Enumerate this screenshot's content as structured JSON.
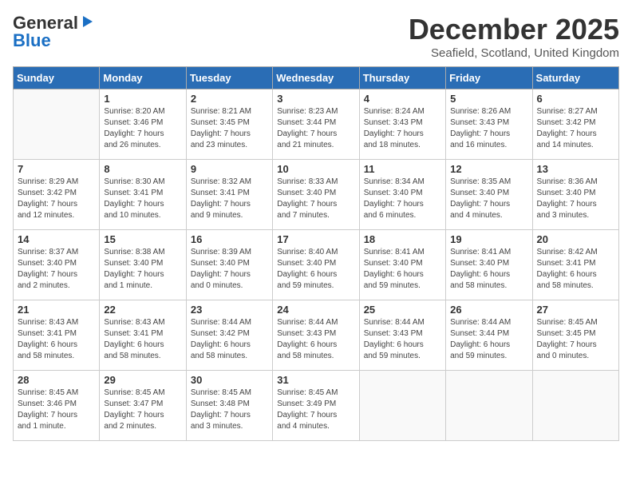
{
  "logo": {
    "line1": "General",
    "line2": "Blue"
  },
  "title": "December 2025",
  "location": "Seafield, Scotland, United Kingdom",
  "weekdays": [
    "Sunday",
    "Monday",
    "Tuesday",
    "Wednesday",
    "Thursday",
    "Friday",
    "Saturday"
  ],
  "weeks": [
    [
      {
        "day": "",
        "info": ""
      },
      {
        "day": "1",
        "info": "Sunrise: 8:20 AM\nSunset: 3:46 PM\nDaylight: 7 hours\nand 26 minutes."
      },
      {
        "day": "2",
        "info": "Sunrise: 8:21 AM\nSunset: 3:45 PM\nDaylight: 7 hours\nand 23 minutes."
      },
      {
        "day": "3",
        "info": "Sunrise: 8:23 AM\nSunset: 3:44 PM\nDaylight: 7 hours\nand 21 minutes."
      },
      {
        "day": "4",
        "info": "Sunrise: 8:24 AM\nSunset: 3:43 PM\nDaylight: 7 hours\nand 18 minutes."
      },
      {
        "day": "5",
        "info": "Sunrise: 8:26 AM\nSunset: 3:43 PM\nDaylight: 7 hours\nand 16 minutes."
      },
      {
        "day": "6",
        "info": "Sunrise: 8:27 AM\nSunset: 3:42 PM\nDaylight: 7 hours\nand 14 minutes."
      }
    ],
    [
      {
        "day": "7",
        "info": "Sunrise: 8:29 AM\nSunset: 3:42 PM\nDaylight: 7 hours\nand 12 minutes."
      },
      {
        "day": "8",
        "info": "Sunrise: 8:30 AM\nSunset: 3:41 PM\nDaylight: 7 hours\nand 10 minutes."
      },
      {
        "day": "9",
        "info": "Sunrise: 8:32 AM\nSunset: 3:41 PM\nDaylight: 7 hours\nand 9 minutes."
      },
      {
        "day": "10",
        "info": "Sunrise: 8:33 AM\nSunset: 3:40 PM\nDaylight: 7 hours\nand 7 minutes."
      },
      {
        "day": "11",
        "info": "Sunrise: 8:34 AM\nSunset: 3:40 PM\nDaylight: 7 hours\nand 6 minutes."
      },
      {
        "day": "12",
        "info": "Sunrise: 8:35 AM\nSunset: 3:40 PM\nDaylight: 7 hours\nand 4 minutes."
      },
      {
        "day": "13",
        "info": "Sunrise: 8:36 AM\nSunset: 3:40 PM\nDaylight: 7 hours\nand 3 minutes."
      }
    ],
    [
      {
        "day": "14",
        "info": "Sunrise: 8:37 AM\nSunset: 3:40 PM\nDaylight: 7 hours\nand 2 minutes."
      },
      {
        "day": "15",
        "info": "Sunrise: 8:38 AM\nSunset: 3:40 PM\nDaylight: 7 hours\nand 1 minute."
      },
      {
        "day": "16",
        "info": "Sunrise: 8:39 AM\nSunset: 3:40 PM\nDaylight: 7 hours\nand 0 minutes."
      },
      {
        "day": "17",
        "info": "Sunrise: 8:40 AM\nSunset: 3:40 PM\nDaylight: 6 hours\nand 59 minutes."
      },
      {
        "day": "18",
        "info": "Sunrise: 8:41 AM\nSunset: 3:40 PM\nDaylight: 6 hours\nand 59 minutes."
      },
      {
        "day": "19",
        "info": "Sunrise: 8:41 AM\nSunset: 3:40 PM\nDaylight: 6 hours\nand 58 minutes."
      },
      {
        "day": "20",
        "info": "Sunrise: 8:42 AM\nSunset: 3:41 PM\nDaylight: 6 hours\nand 58 minutes."
      }
    ],
    [
      {
        "day": "21",
        "info": "Sunrise: 8:43 AM\nSunset: 3:41 PM\nDaylight: 6 hours\nand 58 minutes."
      },
      {
        "day": "22",
        "info": "Sunrise: 8:43 AM\nSunset: 3:41 PM\nDaylight: 6 hours\nand 58 minutes."
      },
      {
        "day": "23",
        "info": "Sunrise: 8:44 AM\nSunset: 3:42 PM\nDaylight: 6 hours\nand 58 minutes."
      },
      {
        "day": "24",
        "info": "Sunrise: 8:44 AM\nSunset: 3:43 PM\nDaylight: 6 hours\nand 58 minutes."
      },
      {
        "day": "25",
        "info": "Sunrise: 8:44 AM\nSunset: 3:43 PM\nDaylight: 6 hours\nand 59 minutes."
      },
      {
        "day": "26",
        "info": "Sunrise: 8:44 AM\nSunset: 3:44 PM\nDaylight: 6 hours\nand 59 minutes."
      },
      {
        "day": "27",
        "info": "Sunrise: 8:45 AM\nSunset: 3:45 PM\nDaylight: 7 hours\nand 0 minutes."
      }
    ],
    [
      {
        "day": "28",
        "info": "Sunrise: 8:45 AM\nSunset: 3:46 PM\nDaylight: 7 hours\nand 1 minute."
      },
      {
        "day": "29",
        "info": "Sunrise: 8:45 AM\nSunset: 3:47 PM\nDaylight: 7 hours\nand 2 minutes."
      },
      {
        "day": "30",
        "info": "Sunrise: 8:45 AM\nSunset: 3:48 PM\nDaylight: 7 hours\nand 3 minutes."
      },
      {
        "day": "31",
        "info": "Sunrise: 8:45 AM\nSunset: 3:49 PM\nDaylight: 7 hours\nand 4 minutes."
      },
      {
        "day": "",
        "info": ""
      },
      {
        "day": "",
        "info": ""
      },
      {
        "day": "",
        "info": ""
      }
    ]
  ]
}
